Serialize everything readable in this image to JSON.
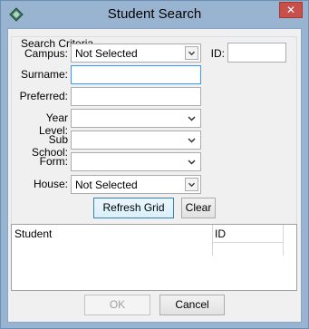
{
  "window": {
    "title": "Student Search",
    "close_glyph": "✕",
    "app_icon": "app-icon"
  },
  "criteria": {
    "legend": "Search Criteria",
    "campus": {
      "label": "Campus:",
      "value": "Not Selected"
    },
    "id": {
      "label": "ID:",
      "value": ""
    },
    "surname": {
      "label": "Surname:",
      "value": ""
    },
    "preferred": {
      "label": "Preferred:",
      "value": ""
    },
    "year_level": {
      "label": "Year Level:",
      "value": ""
    },
    "sub_school": {
      "label": "Sub School:",
      "value": ""
    },
    "form": {
      "label": "Form:",
      "value": ""
    },
    "house": {
      "label": "House:",
      "value": "Not Selected"
    }
  },
  "actions": {
    "refresh_label": "Refresh Grid",
    "clear_label": "Clear"
  },
  "grid": {
    "columns": [
      "Student",
      "ID"
    ],
    "rows": []
  },
  "footer": {
    "ok_label": "OK",
    "cancel_label": "Cancel"
  }
}
